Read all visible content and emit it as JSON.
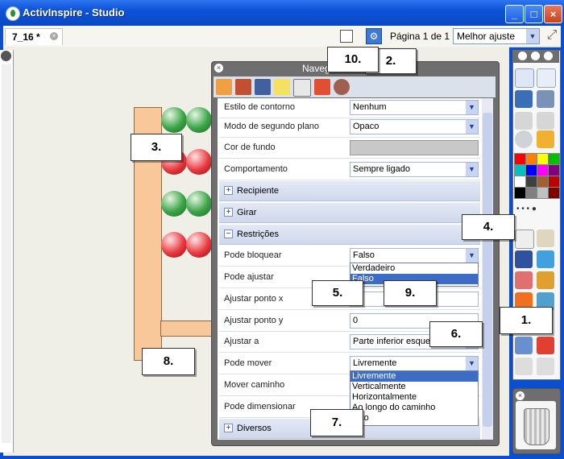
{
  "window": {
    "title": "ActivInspire - Studio",
    "buttons": [
      "_",
      "□",
      "×"
    ]
  },
  "tabbar": {
    "doc_tab": "7_16 *",
    "page_label": "Página 1 de 1",
    "zoom": "Melhor ajuste"
  },
  "navigator": {
    "title": "Navegador",
    "rows_top": [
      {
        "label": "Estilo de contorno",
        "value": "Nenhum"
      },
      {
        "label": "Modo de segundo plano",
        "value": "Opaco"
      },
      {
        "label": "Cor de fundo",
        "value": ""
      },
      {
        "label": "Comportamento",
        "value": "Sempre ligado"
      }
    ],
    "sections": [
      "Recipiente",
      "Girar",
      "Restrições",
      "Diversos"
    ],
    "restrictions": [
      {
        "label": "Pode bloquear",
        "value": "Falso"
      },
      {
        "label": "Pode ajustar",
        "value": ""
      },
      {
        "label": "Ajustar ponto x",
        "value": ""
      },
      {
        "label": "Ajustar ponto y",
        "value": "0"
      },
      {
        "label": "Ajustar a",
        "value": "Parte inferior esquerda"
      },
      {
        "label": "Pode mover",
        "value": "Livremente"
      },
      {
        "label": "Mover caminho",
        "value": ""
      },
      {
        "label": "Pode dimensionar",
        "value": ""
      }
    ],
    "bloquear_options": [
      "Verdadeiro",
      "Falso"
    ],
    "mover_options": [
      "Livremente",
      "Verticalmente",
      "Horizontalmente",
      "Ao longo do caminho",
      "Fixo"
    ]
  },
  "callouts": [
    "1.",
    "2.",
    "3.",
    "4.",
    "5.",
    "6.",
    "7.",
    "8.",
    "9.",
    "10."
  ],
  "colors": {
    "titlebar": "#0d52d8",
    "accent": "#3d6cc7",
    "bead_green": "#3aa346",
    "bead_red": "#e8393f",
    "post": "#f8c89a"
  }
}
